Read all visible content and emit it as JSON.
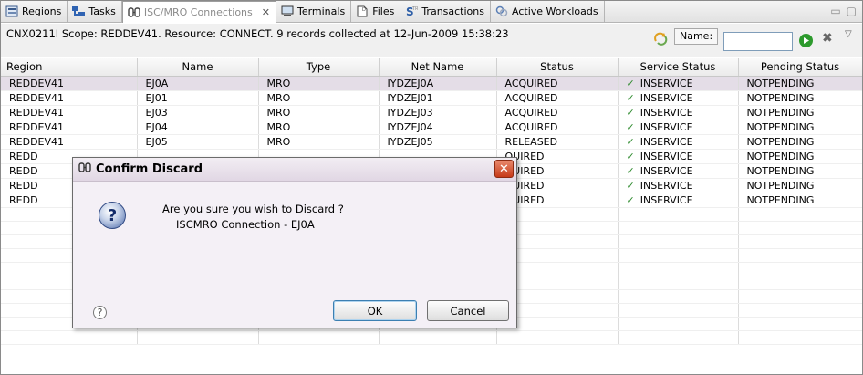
{
  "tabs": [
    {
      "label": "Regions",
      "icon": "regions-icon"
    },
    {
      "label": "Tasks",
      "icon": "tasks-icon"
    },
    {
      "label": "ISC/MRO Connections",
      "icon": "connections-icon",
      "active": true
    },
    {
      "label": "Terminals",
      "icon": "terminals-icon"
    },
    {
      "label": "Files",
      "icon": "files-icon"
    },
    {
      "label": "Transactions",
      "icon": "transactions-icon"
    },
    {
      "label": "Active Workloads",
      "icon": "workloads-icon"
    }
  ],
  "info": {
    "message": "CNX0211I Scope: REDDEV41. Resource: CONNECT. 9 records collected at 12-Jun-2009 15:38:23",
    "name_label": "Name:",
    "name_value": ""
  },
  "table": {
    "columns": [
      "Region",
      "Name",
      "Type",
      "Net Name",
      "Status",
      "Service Status",
      "Pending Status"
    ],
    "rows": [
      [
        "REDDEV41",
        "EJ0A",
        "MRO",
        "IYDZEJ0A",
        "ACQUIRED",
        "INSERVICE",
        "NOTPENDING"
      ],
      [
        "REDDEV41",
        "EJ01",
        "MRO",
        "IYDZEJ01",
        "ACQUIRED",
        "INSERVICE",
        "NOTPENDING"
      ],
      [
        "REDDEV41",
        "EJ03",
        "MRO",
        "IYDZEJ03",
        "ACQUIRED",
        "INSERVICE",
        "NOTPENDING"
      ],
      [
        "REDDEV41",
        "EJ04",
        "MRO",
        "IYDZEJ04",
        "ACQUIRED",
        "INSERVICE",
        "NOTPENDING"
      ],
      [
        "REDDEV41",
        "EJ05",
        "MRO",
        "IYDZEJ05",
        "RELEASED",
        "INSERVICE",
        "NOTPENDING"
      ],
      [
        "REDD",
        "",
        "",
        "",
        "QUIRED",
        "INSERVICE",
        "NOTPENDING"
      ],
      [
        "REDD",
        "",
        "",
        "",
        "QUIRED",
        "INSERVICE",
        "NOTPENDING"
      ],
      [
        "REDD",
        "",
        "",
        "",
        "QUIRED",
        "INSERVICE",
        "NOTPENDING"
      ],
      [
        "REDD",
        "",
        "",
        "",
        "QUIRED",
        "INSERVICE",
        "NOTPENDING"
      ]
    ],
    "selected_row": 0,
    "empty_rows": 10
  },
  "dialog": {
    "title": "Confirm Discard",
    "message": "Are you sure you wish to Discard ?",
    "detail": "ISCMRO Connection - EJ0A",
    "ok_label": "OK",
    "cancel_label": "Cancel",
    "close_glyph": "✕",
    "question_glyph": "?",
    "help_glyph": "?"
  },
  "colors": {
    "selection": "#e4dde7",
    "dialog_bg": "#f3eff5",
    "check": "#2d8a2d",
    "close_button": "#c63a18"
  }
}
